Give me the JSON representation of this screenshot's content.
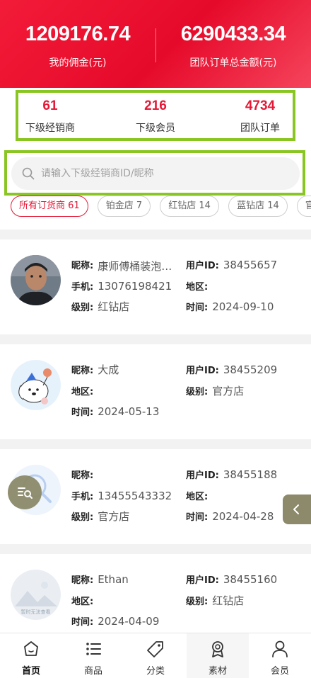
{
  "header": {
    "commission_value": "1209176.74",
    "commission_label": "我的佣金(元)",
    "team_total_value": "6290433.34",
    "team_total_label": "团队订单总金额(元)"
  },
  "stats": [
    {
      "value": "61",
      "label": "下级经销商"
    },
    {
      "value": "216",
      "label": "下级会员"
    },
    {
      "value": "4734",
      "label": "团队订单"
    }
  ],
  "search": {
    "placeholder": "请输入下级经销商ID/昵称"
  },
  "filters": [
    {
      "label": "所有订货商 61",
      "active": true
    },
    {
      "label": "铂金店 7",
      "active": false
    },
    {
      "label": "红钻店 14",
      "active": false
    },
    {
      "label": "蓝钻店 14",
      "active": false
    },
    {
      "label": "官",
      "active": false
    }
  ],
  "labels": {
    "nickname": "昵称:",
    "user_id": "用户ID:",
    "phone": "手机:",
    "region": "地区:",
    "level": "级别:",
    "time": "时间:"
  },
  "dealers": [
    {
      "nickname": "康师傅桶装泡…",
      "user_id": "38455657",
      "phone": "13076198421",
      "region": "",
      "level": "红钻店",
      "time": "2024-09-10",
      "avatar": "photo-avatar"
    },
    {
      "nickname": "大成",
      "user_id": "38455209",
      "region": "",
      "level": "官方店",
      "time": "2024-05-13",
      "avatar": "cartoon-dog-avatar"
    },
    {
      "nickname": "",
      "user_id": "38455188",
      "phone": "13455543332",
      "region": "",
      "level": "官方店",
      "time": "2024-04-28",
      "avatar": "search-placeholder-avatar"
    },
    {
      "nickname": "Ethan",
      "user_id": "38455160",
      "region": "",
      "level": "红钻店",
      "time": "2024-04-09",
      "avatar": "image-unavailable-avatar",
      "avatar_text": "暂时无法查看"
    }
  ],
  "tabs": [
    {
      "label": "首页",
      "icon": "home-icon"
    },
    {
      "label": "商品",
      "icon": "list-icon"
    },
    {
      "label": "分类",
      "icon": "tag-icon"
    },
    {
      "label": "素材",
      "icon": "badge-icon"
    },
    {
      "label": "会员",
      "icon": "user-icon"
    }
  ],
  "colors": {
    "brand_red": "#e51937",
    "highlight_green": "#8ac623",
    "fab": "#8c8a6a"
  }
}
